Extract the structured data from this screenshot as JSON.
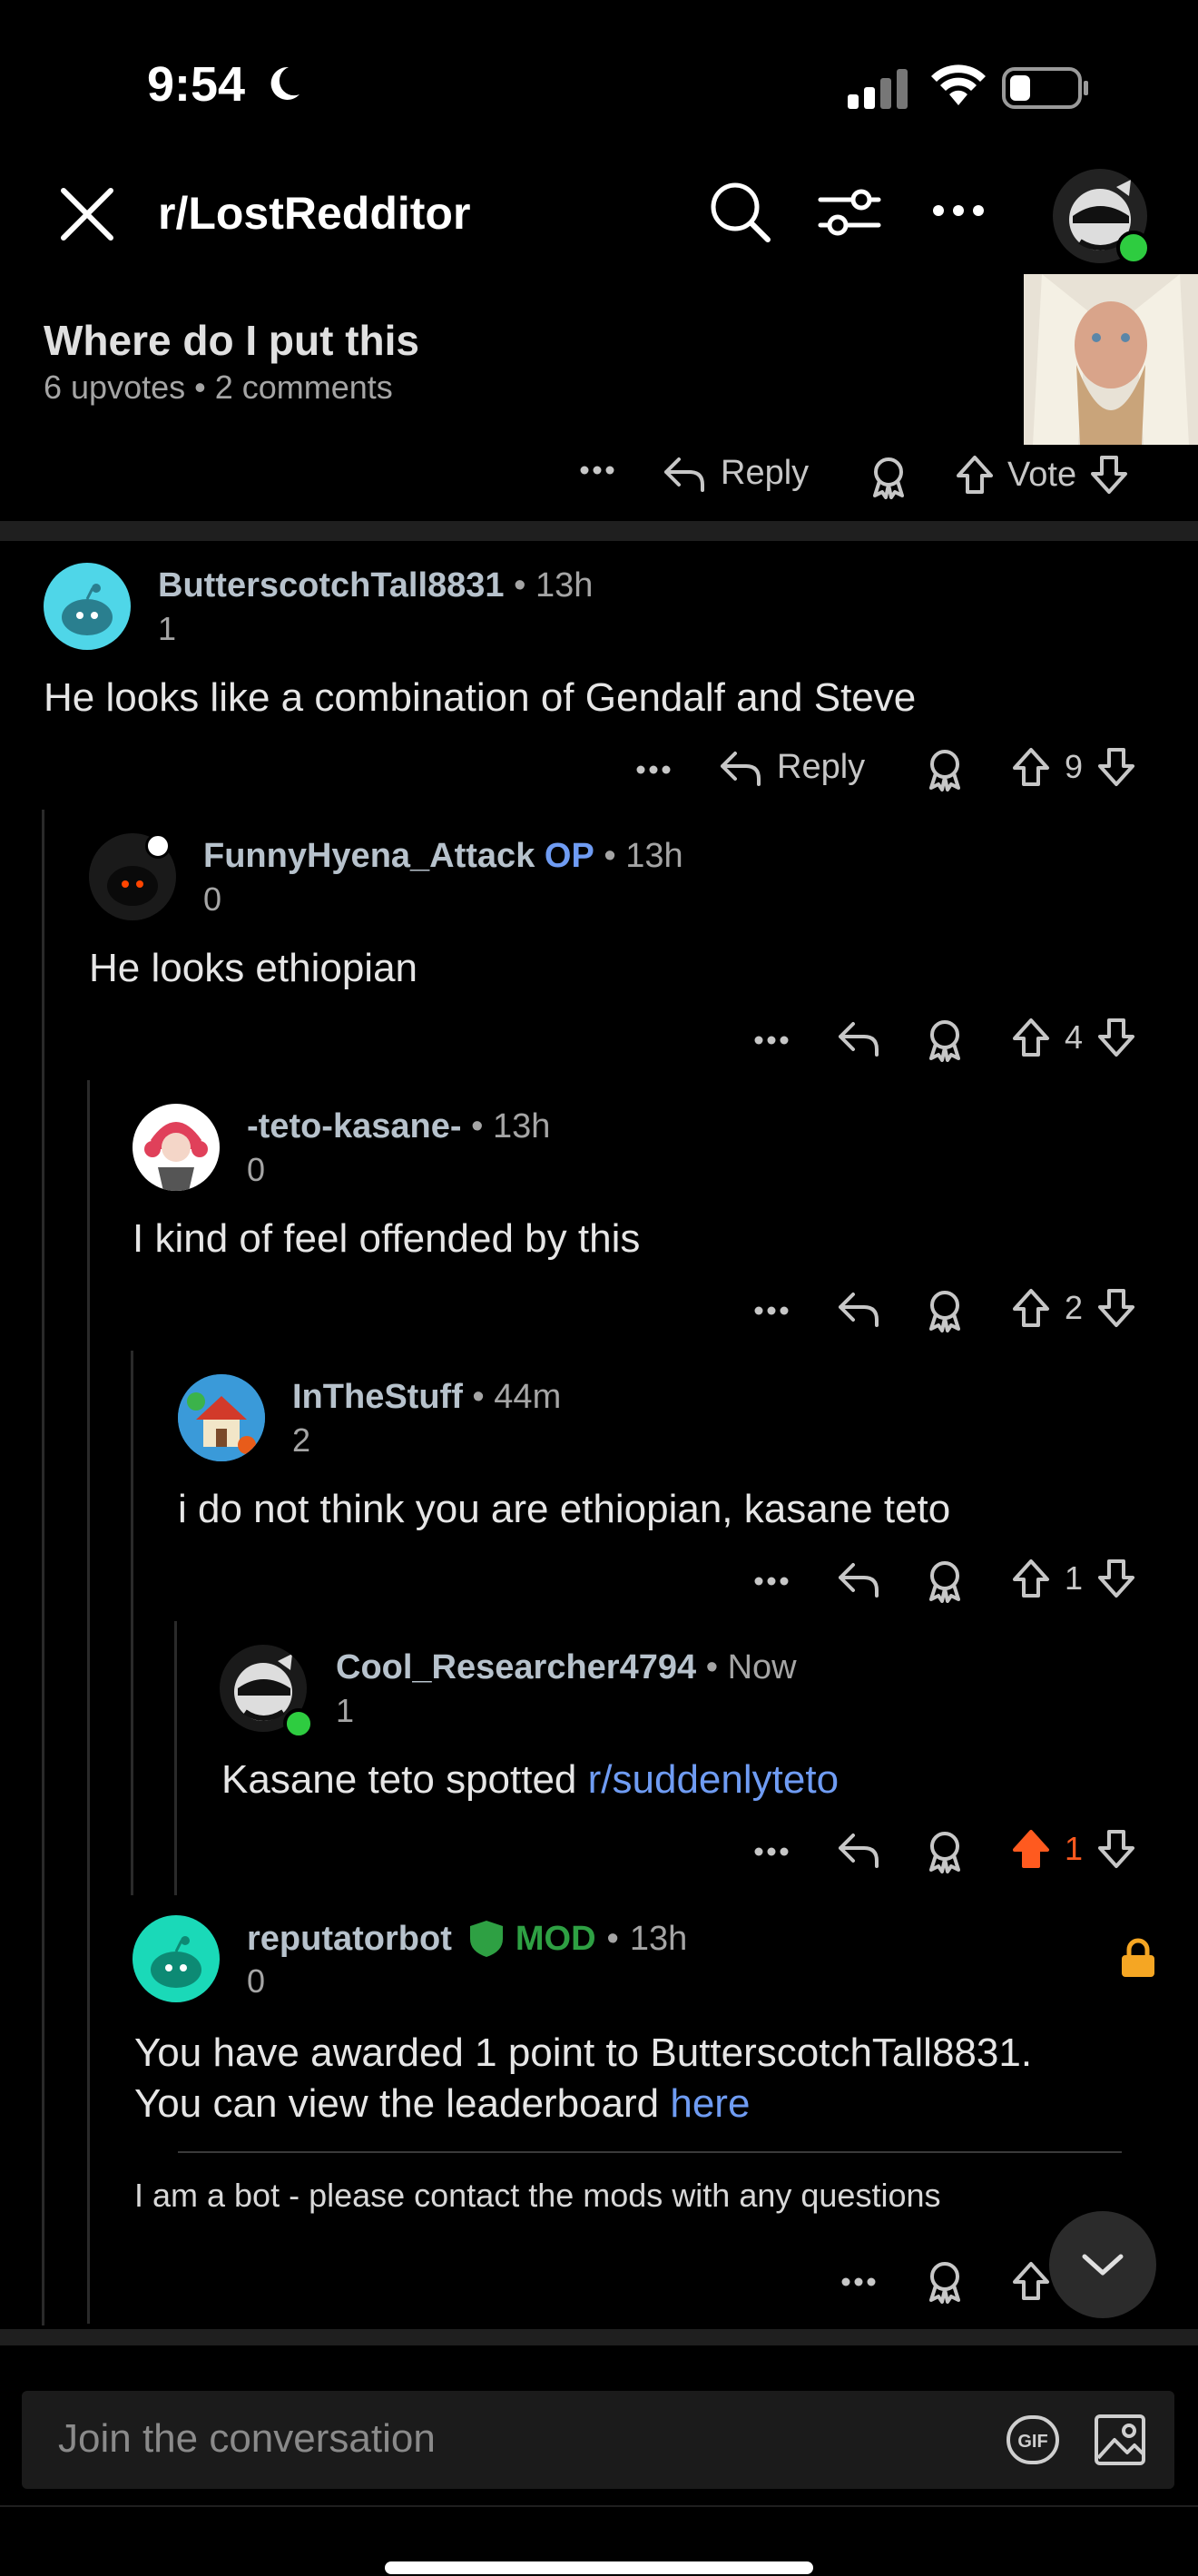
{
  "status_bar": {
    "time": "9:54"
  },
  "header": {
    "subreddit": "r/LostRedditor"
  },
  "post": {
    "title": "Where do I put this",
    "meta": "6 upvotes • 2 comments",
    "reply_label": "Reply",
    "vote_label": "Vote"
  },
  "comments": [
    {
      "username": "ButterscotchTall8831",
      "sep": "•",
      "time": "13h",
      "score": "1",
      "text": "He looks like a combination of Gendalf and Steve",
      "reply_label": "Reply",
      "votes": "9"
    },
    {
      "username": "FunnyHyena_Attack",
      "tag": "OP",
      "sep": "•",
      "time": "13h",
      "score": "0",
      "text": "He looks ethiopian",
      "votes": "4"
    },
    {
      "username": "-teto-kasane-",
      "sep": "•",
      "time": "13h",
      "score": "0",
      "text": "I kind of feel offended by this",
      "votes": "2"
    },
    {
      "username": "InTheStuff",
      "sep": "•",
      "time": "44m",
      "score": "2",
      "text": "i do not think you are ethiopian, kasane teto",
      "votes": "1"
    },
    {
      "username": "Cool_Researcher4794",
      "sep": "•",
      "time": "Now",
      "score": "1",
      "text": "Kasane teto spotted ",
      "link": "r/suddenlyteto",
      "votes": "1"
    },
    {
      "username": "reputatorbot",
      "tag": "MOD",
      "sep": "•",
      "time": "13h",
      "score": "0",
      "text_line1": "You have awarded 1 point to ButterscotchTall8831.",
      "text_line2": "You can view the leaderboard ",
      "link": "here",
      "note": "I am a bot - please contact the mods with any questions"
    }
  ],
  "composer": {
    "placeholder": "Join the conversation"
  },
  "colors": {
    "upvoted": "#ff5a1f",
    "link": "#6f9cf3",
    "mod": "#2ea043",
    "online": "#2ecc40",
    "lock": "#f5a623"
  },
  "icons": [
    "close-icon",
    "search-icon",
    "filter-icon",
    "more-icon",
    "avatar",
    "reply-icon",
    "award-icon",
    "upvote-icon",
    "downvote-icon",
    "lock-icon",
    "chevron-down-icon",
    "gif-icon",
    "image-icon"
  ]
}
